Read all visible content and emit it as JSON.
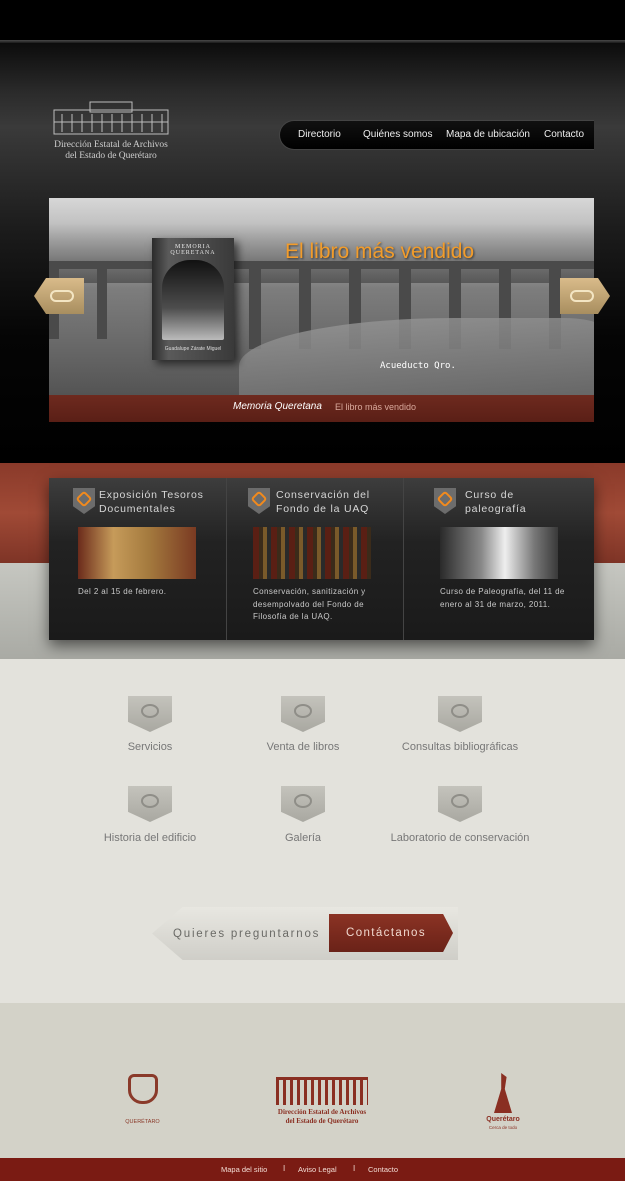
{
  "header": {
    "logo_line1": "Dirección Estatal de Archivos",
    "logo_line2": "del Estado de Querétaro",
    "nav": [
      "Directorio",
      "Quiénes somos",
      "Mapa de ubicación",
      "Contacto"
    ]
  },
  "slider": {
    "headline": "El libro más vendido",
    "book_title": "MEMORIA QUERETANA",
    "book_author": "Guadalupe Zárate Miguel",
    "photo_caption": "Acueducto Qro.",
    "caption_title": "Memoria Queretana",
    "caption_sub": "El libro más vendido"
  },
  "news": [
    {
      "title": "Exposición Tesoros Documentales",
      "text": "Del 2 al 15 de febrero."
    },
    {
      "title": "Conservación del Fondo de la UAQ",
      "text": "Conservación, sanitización y desempolvado del Fondo de Filosofía de la UAQ."
    },
    {
      "title": "Curso de paleografía",
      "text": "Curso de Paleografía, del 11 de enero al 31 de marzo, 2011."
    }
  ],
  "services": [
    "Servicios",
    "Venta de libros",
    "Consultas bibliográficas",
    "Historia del edificio",
    "Galería",
    "Laboratorio de conservación"
  ],
  "cta": {
    "question": "Quieres preguntarnos",
    "button": "Contáctanos"
  },
  "footer": {
    "seal_text": "QUERÉTARO",
    "logo_line1": "Dirección Estatal de Archivos",
    "logo_line2": "del Estado de Querétaro",
    "qro_name": "Querétaro",
    "qro_tag": "Cerca de todo",
    "links": [
      "Mapa del sitio",
      "Aviso Legal",
      "Contacto"
    ],
    "separator": "I"
  },
  "colors": {
    "accent": "#f29c2b",
    "brand_red": "#7a1b13"
  }
}
